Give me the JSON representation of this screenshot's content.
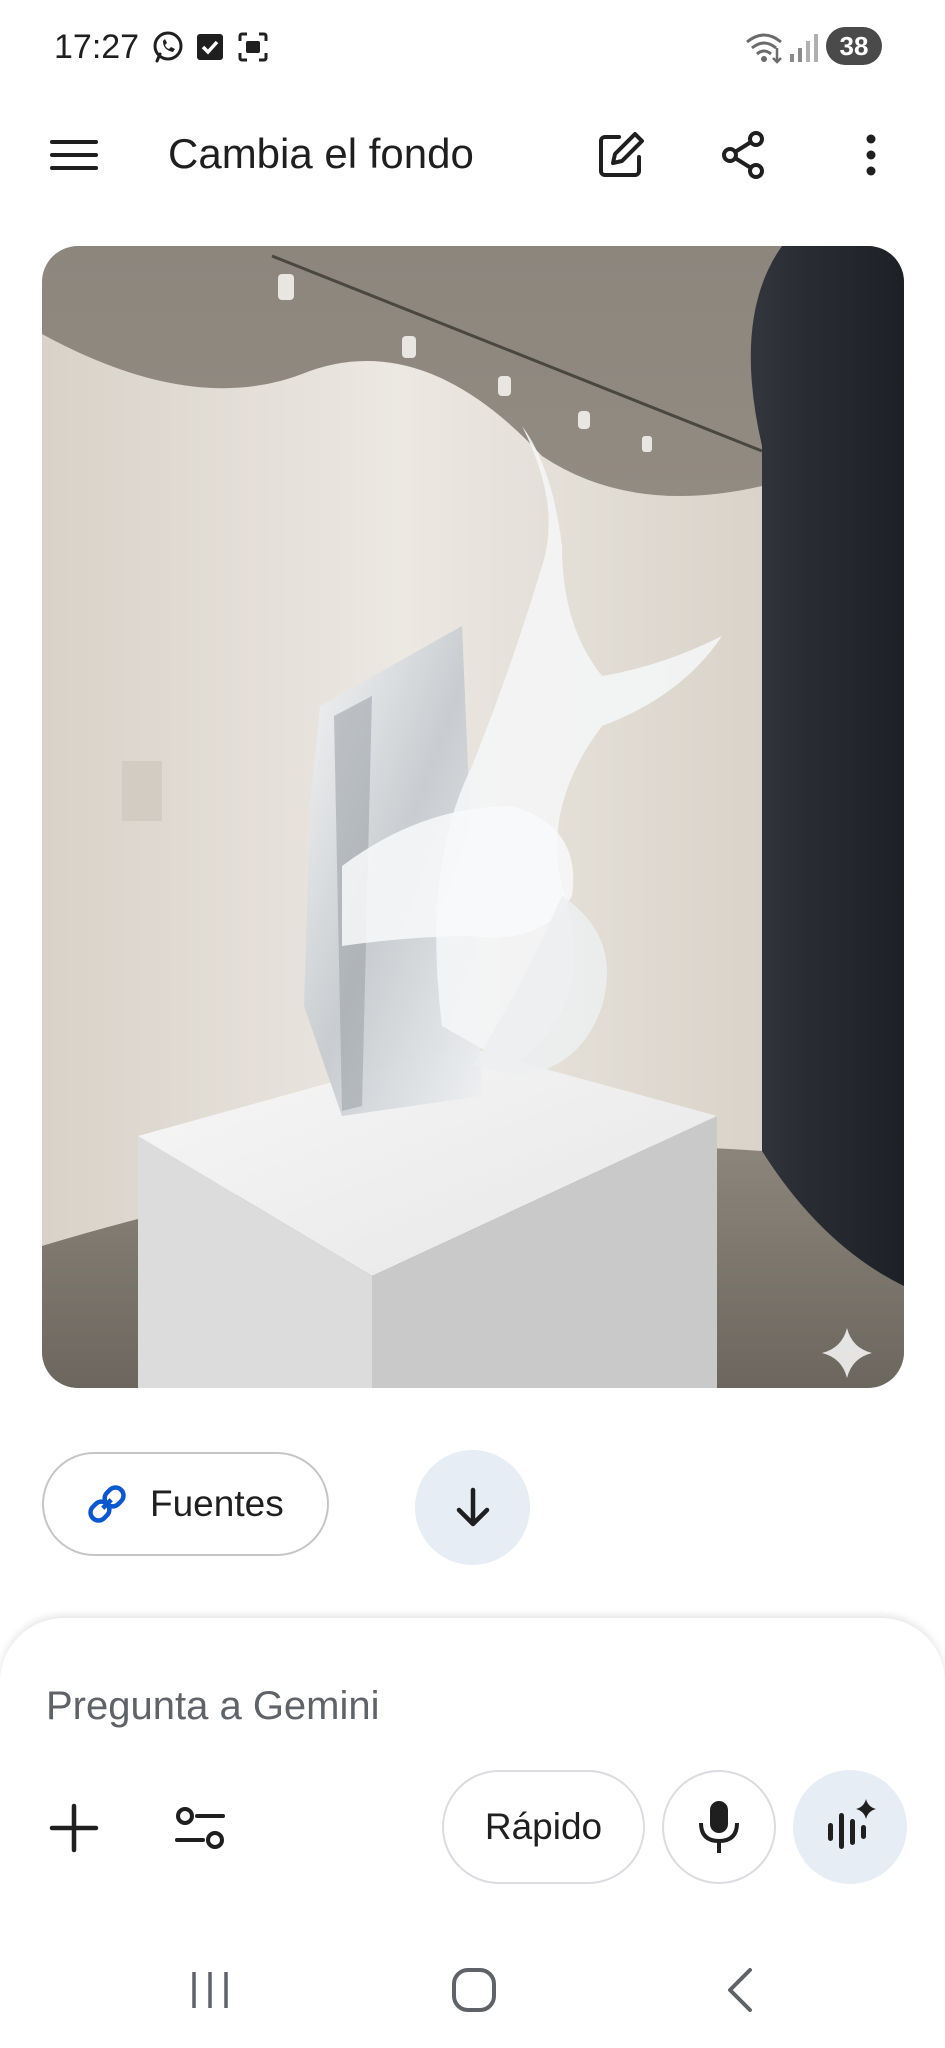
{
  "status_bar": {
    "time": "17:27",
    "battery": "38",
    "icons": [
      "whatsapp-icon",
      "checkbox-notification-icon",
      "screenshot-icon",
      "wifi-icon",
      "signal-icon",
      "battery-icon"
    ]
  },
  "app_bar": {
    "title": "Cambia el fondo",
    "menu_icon": "hamburger-menu-icon",
    "actions": [
      "edit-icon",
      "share-icon",
      "more-vert-icon"
    ]
  },
  "generated_image": {
    "subject": "crystal-sculpture-gallery",
    "badge_icon": "sparkle-icon"
  },
  "sources": {
    "label": "Fuentes",
    "icon": "link-icon"
  },
  "scroll_button": {
    "icon": "arrow-down-icon"
  },
  "composer": {
    "placeholder": "Pregunta a Gemini",
    "value": "",
    "mode_label": "Rápido",
    "tools": [
      "plus-icon",
      "tools-icon",
      "mic-icon",
      "live-icon"
    ]
  },
  "navigation": {
    "icons": [
      "recents-icon",
      "home-icon",
      "back-icon"
    ]
  },
  "colors": {
    "text": "#1f1f1f",
    "placeholder": "#5f6368",
    "accent_blue": "#0b57d0",
    "soft_blue": "#e7edf5",
    "outline": "#c4c7c5"
  }
}
